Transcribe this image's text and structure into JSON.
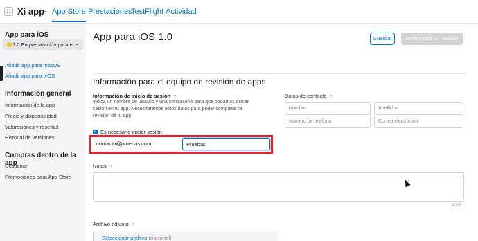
{
  "topbar": {
    "app_name": "Xi app",
    "tabs": [
      "App Store",
      "Prestaciones",
      "TestFlight",
      "Actividad"
    ],
    "active_tab": "App Store"
  },
  "sidebar": {
    "section_ios": "App para iOS",
    "selected_version": "1.0 En preparación para el e...",
    "add_macos": "Añadir app para macOS",
    "add_tvos": "Añadir app para tvOS",
    "section_general": "Información general",
    "general_items": [
      "Información de la app",
      "Precio y disponibilidad",
      "Valoraciones y reseñas",
      "Historial de versiones"
    ],
    "section_purchases": "Compras dentro de la app",
    "purchase_items": [
      "Gestionar",
      "Promociones para App Store"
    ]
  },
  "main": {
    "page_title": "App para iOS 1.0",
    "save_button": "Guardar",
    "submit_button": "Enviar para su revisión",
    "section_title": "Información para el equipo de revisión de apps",
    "signin_label": "Información de inicio de sesión",
    "signin_desc": "Indica un nombre de usuario y una contraseña para que podamos iniciar sesión en tu app. Necesitaremos estos datos para poder completar la revisión de tu app.",
    "signin_required_label": "Es necesario iniciar sesión",
    "username_value": "contacto@pruebas.com",
    "password_value": "Pruebas",
    "contact_label": "Datos de contacto",
    "contact_placeholders": {
      "first_name": "Nombre",
      "last_name": "Apellidos",
      "phone": "Número de teléfono",
      "email": "Correo electrónico"
    },
    "notes_label": "Notas",
    "notes_counter": "4000",
    "attachment_label": "Archivo adjunto",
    "attachment_link": "Seleccionar archivo",
    "attachment_optional": "(opcional)"
  },
  "colors": {
    "accent": "#0070c9",
    "highlight": "#e3262f"
  },
  "icons": [
    "app-grid-icon",
    "chevron-down-icon",
    "help-icon",
    "status-dot-icon",
    "checkbox-checked-icon",
    "mouse-cursor-icon"
  ]
}
